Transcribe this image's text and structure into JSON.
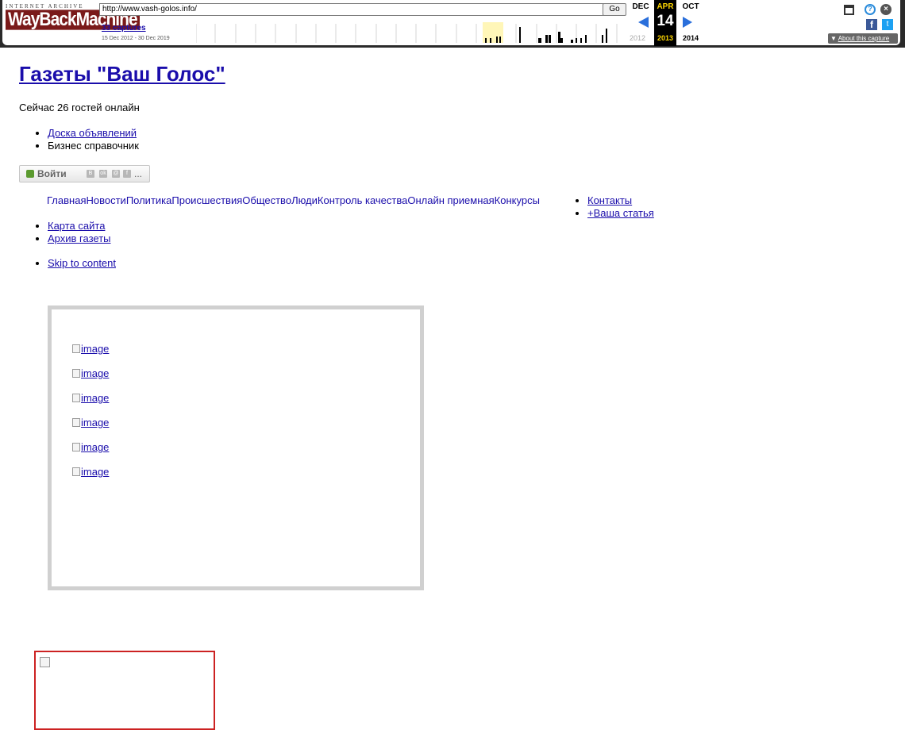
{
  "wayback": {
    "logo_top": "INTERNET ARCHIVE",
    "logo_main": "WayBackMachine",
    "url_value": "http://www.vash-golos.info/",
    "go_label": "Go",
    "captures_label": "33 captures",
    "date_range": "15 Dec 2012 - 30 Dec 2019",
    "prev_month": "DEC",
    "current_month": "APR",
    "next_month": "OCT",
    "current_day": "14",
    "prev_year": "2012",
    "current_year": "2013",
    "next_year": "2014",
    "about_label": "About this capture",
    "colors": {
      "accent": "#2a6fdb",
      "highlight": "#ffd700",
      "bar": "#000000"
    }
  },
  "site": {
    "title": "Газеты \"Ваш Голос\"",
    "guests_online": "Сейчас 26 гостей онлайн",
    "top_menu": [
      "Доска объявлений",
      "Бизнес справочник"
    ],
    "login_label": "Войти",
    "login_more": "...",
    "nav": [
      "Главная",
      "Новости",
      "Политика",
      "Происшествия",
      "Общество",
      "Люди",
      "Контроль качества",
      "Онлайн приемная",
      "Конкурсы"
    ],
    "nav_sub": [
      "Контакты",
      "+Ваша статья"
    ],
    "bottom_menu": [
      "Карта сайта",
      "Архив газеты"
    ],
    "skip_link": "Skip to content",
    "gallery_images": [
      "image",
      "image",
      "image",
      "image",
      "image",
      "image"
    ]
  }
}
